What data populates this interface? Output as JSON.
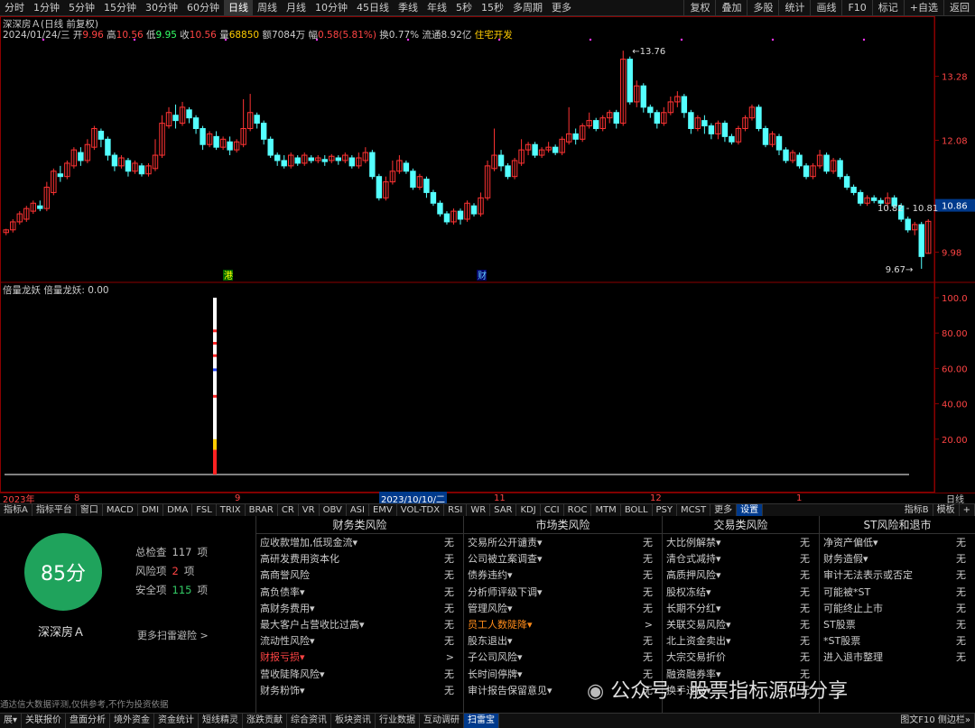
{
  "top_toolbar": {
    "periods": [
      "分时",
      "1分钟",
      "5分钟",
      "15分钟",
      "30分钟",
      "60分钟",
      "日线",
      "周线",
      "月线",
      "10分钟",
      "45日线",
      "季线",
      "年线",
      "5秒",
      "15秒",
      "多周期",
      "更多"
    ],
    "active_period": "日线",
    "right_buttons": [
      "复权",
      "叠加",
      "多股",
      "统计",
      "画线",
      "F10",
      "标记",
      "+自选",
      "返回"
    ]
  },
  "stock_header": {
    "title": "深深房Ａ(日线 前复权)",
    "date": "2024/01/24/三",
    "open_label": "开",
    "open": "9.96",
    "high_label": "高",
    "high": "10.56",
    "low_label": "低",
    "low": "9.95",
    "close_label": "收",
    "close": "10.56",
    "volume_label": "量",
    "volume": "68850",
    "amount_label": "额",
    "amount": "7084万",
    "change_label": "幅",
    "change": "0.58(5.81%)",
    "turnover_label": "换",
    "turnover": "0.77%",
    "float_label": "流通",
    "float": "8.92亿",
    "sector": "住宅开发"
  },
  "price_axis": {
    "ticks": [
      "13.28",
      "12.08",
      "10.86",
      "9.98"
    ],
    "current": "10.86"
  },
  "annotations": {
    "high_mark": "13.76",
    "low_mark": "9.67",
    "range_label": "10.82 - 10.81",
    "marker_a": "港",
    "marker_b": "财"
  },
  "colors": {
    "up": "#ff3333",
    "down": "#54ffff",
    "grid": "#8b0000",
    "accent": "#003a8c",
    "score_bg": "#1fa35c"
  },
  "indicator": {
    "title": "倍量龙妖  倍量龙妖: 0.00",
    "ticks": [
      "100.0",
      "80.00",
      "60.00",
      "40.00",
      "20.00"
    ]
  },
  "timeline": {
    "labels": [
      "2023年",
      "8",
      "9",
      "2023/10/10/二",
      "11",
      "12",
      "1"
    ],
    "right": "日线"
  },
  "indicator_tabs": {
    "items": [
      "指标A",
      "指标平台",
      "窗口",
      "MACD",
      "DMI",
      "DMA",
      "FSL",
      "TRIX",
      "BRAR",
      "CR",
      "VR",
      "OBV",
      "ASI",
      "EMV",
      "VOL-TDX",
      "RSI",
      "WR",
      "SAR",
      "KDJ",
      "CCI",
      "ROC",
      "MTM",
      "BOLL",
      "PSY",
      "MCST",
      "更多",
      "设置"
    ],
    "right": [
      "指标B",
      "模板",
      "+"
    ]
  },
  "risk_panel": {
    "score": "85分",
    "stock_name": "深深房Ａ",
    "total_label": "总检查",
    "total": "117",
    "unit": "项",
    "risk_label": "风险项",
    "risk": "2",
    "safe_label": "安全项",
    "safe": "115",
    "more": "更多扫雷避险 >",
    "columns": [
      {
        "title": "财务类风险",
        "rows": [
          {
            "label": "应收款增加,低现金流▾",
            "status": "无"
          },
          {
            "label": "高研发费用资本化",
            "status": "无"
          },
          {
            "label": "高商誉风险",
            "status": "无"
          },
          {
            "label": "高负债率▾",
            "status": "无"
          },
          {
            "label": "高财务费用▾",
            "status": "无"
          },
          {
            "label": "最大客户占营收比过高▾",
            "status": "无"
          },
          {
            "label": "流动性风险▾",
            "status": "无"
          },
          {
            "label": "财报亏损▾",
            "status": ">",
            "level": "bad"
          },
          {
            "label": "营收陡降风险▾",
            "status": "无"
          },
          {
            "label": "财务粉饰▾",
            "status": "无"
          }
        ]
      },
      {
        "title": "市场类风险",
        "rows": [
          {
            "label": "交易所公开谴责▾",
            "status": "无"
          },
          {
            "label": "公司被立案调查▾",
            "status": "无"
          },
          {
            "label": "债券违约▾",
            "status": "无"
          },
          {
            "label": "分析师评级下调▾",
            "status": "无"
          },
          {
            "label": "管理风险▾",
            "status": "无"
          },
          {
            "label": "员工人数陡降▾",
            "status": ">",
            "level": "warn"
          },
          {
            "label": "股东退出▾",
            "status": "无"
          },
          {
            "label": "子公司风险▾",
            "status": "无"
          },
          {
            "label": "长时间停牌▾",
            "status": "无"
          },
          {
            "label": "审计报告保留意见▾",
            "status": "无"
          }
        ]
      },
      {
        "title": "交易类风险",
        "rows": [
          {
            "label": "大比例解禁▾",
            "status": "无"
          },
          {
            "label": "清仓式减持▾",
            "status": "无"
          },
          {
            "label": "高质押风险▾",
            "status": "无"
          },
          {
            "label": "股权冻结▾",
            "status": "无"
          },
          {
            "label": "长期不分红▾",
            "status": "无"
          },
          {
            "label": "关联交易风险▾",
            "status": "无"
          },
          {
            "label": "北上资金卖出▾",
            "status": "无"
          },
          {
            "label": "大宗交易折价",
            "status": "无"
          },
          {
            "label": "融资融券率▾",
            "status": "无"
          },
          {
            "label": "换手过高▾",
            "status": "无"
          }
        ]
      },
      {
        "title": "ST风险和退市",
        "rows": [
          {
            "label": "净资产偏低▾",
            "status": "无"
          },
          {
            "label": "财务造假▾",
            "status": "无"
          },
          {
            "label": "审计无法表示或否定",
            "status": "无"
          },
          {
            "label": "可能被*ST",
            "status": "无"
          },
          {
            "label": "可能终止上市",
            "status": "无"
          },
          {
            "label": "ST股票",
            "status": "无"
          },
          {
            "label": "*ST股票",
            "status": "无"
          },
          {
            "label": "进入退市整理",
            "status": "无"
          }
        ]
      }
    ],
    "disclaimer": "通达信大数据评测,仅供参考,不作为投资依据"
  },
  "watermark": "公众号 · 股票指标源码分享",
  "bottom_bar": {
    "items": [
      "展▾",
      "关联报价",
      "盘面分析",
      "境外资金",
      "资金统计",
      "短线精灵",
      "涨跌贡献",
      "综合资讯",
      "板块资讯",
      "行业数据",
      "互动调研",
      "扫雷宝"
    ],
    "active": "扫雷宝",
    "right": "图文F10 侧边栏»"
  },
  "chart_data": {
    "type": "candlestick",
    "title": "深深房Ａ(日线 前复权)",
    "ylim": [
      9.5,
      14.0
    ],
    "candles": [
      [
        10.35,
        10.4,
        10.3,
        10.42
      ],
      [
        10.4,
        10.55,
        10.35,
        10.6
      ],
      [
        10.55,
        10.7,
        10.5,
        10.75
      ],
      [
        10.6,
        10.8,
        10.55,
        10.85
      ],
      [
        10.75,
        10.9,
        10.7,
        10.95
      ],
      [
        10.85,
        10.8,
        10.75,
        10.95
      ],
      [
        10.8,
        11.2,
        10.75,
        11.3
      ],
      [
        11.1,
        11.5,
        11.05,
        11.55
      ],
      [
        11.45,
        11.4,
        11.3,
        11.6
      ],
      [
        11.4,
        11.65,
        11.35,
        11.7
      ],
      [
        11.6,
        11.9,
        11.55,
        11.95
      ],
      [
        11.85,
        11.7,
        11.6,
        11.95
      ],
      [
        11.7,
        12.0,
        11.65,
        12.1
      ],
      [
        11.95,
        12.3,
        11.9,
        12.35
      ],
      [
        12.25,
        12.1,
        11.95,
        12.3
      ],
      [
        12.1,
        11.8,
        11.7,
        12.15
      ],
      [
        11.8,
        11.6,
        11.5,
        11.85
      ],
      [
        11.6,
        11.75,
        11.55,
        11.8
      ],
      [
        11.7,
        11.5,
        11.4,
        11.75
      ],
      [
        11.5,
        11.65,
        11.45,
        11.7
      ],
      [
        11.6,
        11.45,
        11.4,
        11.65
      ],
      [
        11.45,
        11.6,
        11.4,
        11.65
      ],
      [
        11.55,
        11.8,
        11.5,
        12.1
      ],
      [
        11.8,
        12.4,
        11.75,
        12.55
      ],
      [
        12.35,
        12.6,
        12.3,
        12.7
      ],
      [
        12.55,
        12.45,
        12.3,
        12.75
      ],
      [
        12.4,
        12.7,
        12.35,
        12.8
      ],
      [
        12.65,
        12.5,
        12.4,
        12.7
      ],
      [
        12.5,
        12.3,
        12.2,
        12.55
      ],
      [
        12.3,
        12.0,
        11.9,
        12.35
      ],
      [
        12.0,
        12.2,
        11.95,
        12.25
      ],
      [
        12.15,
        11.95,
        11.9,
        12.25
      ],
      [
        11.95,
        12.1,
        11.9,
        12.15
      ],
      [
        12.05,
        11.9,
        11.8,
        12.15
      ],
      [
        11.9,
        12.05,
        11.85,
        12.1
      ],
      [
        12.0,
        12.3,
        11.95,
        12.85
      ],
      [
        12.3,
        12.6,
        12.25,
        12.95
      ],
      [
        12.55,
        12.4,
        12.3,
        12.6
      ],
      [
        12.4,
        12.1,
        12.0,
        12.45
      ],
      [
        12.1,
        11.8,
        11.75,
        12.15
      ],
      [
        11.8,
        11.7,
        11.6,
        11.85
      ],
      [
        11.7,
        11.6,
        11.55,
        11.8
      ],
      [
        11.6,
        11.8,
        11.55,
        11.85
      ],
      [
        11.75,
        11.65,
        11.6,
        11.8
      ],
      [
        11.65,
        11.8,
        11.6,
        11.85
      ],
      [
        11.75,
        11.7,
        11.65,
        11.8
      ],
      [
        11.7,
        11.75,
        11.65,
        11.8
      ],
      [
        11.72,
        11.68,
        11.6,
        11.8
      ],
      [
        11.7,
        11.78,
        11.65,
        11.82
      ],
      [
        11.75,
        11.7,
        11.62,
        11.8
      ],
      [
        11.7,
        11.8,
        11.65,
        11.85
      ],
      [
        11.75,
        11.6,
        11.55,
        11.8
      ],
      [
        11.6,
        11.75,
        11.55,
        11.85
      ],
      [
        11.7,
        11.85,
        11.65,
        11.95
      ],
      [
        11.85,
        11.4,
        11.35,
        11.9
      ],
      [
        11.4,
        11.0,
        10.95,
        11.45
      ],
      [
        11.0,
        11.3,
        10.95,
        11.4
      ],
      [
        11.3,
        11.5,
        11.25,
        11.7
      ],
      [
        11.5,
        11.7,
        11.45,
        11.8
      ],
      [
        11.65,
        11.5,
        11.45,
        11.7
      ],
      [
        11.5,
        11.2,
        11.15,
        11.55
      ],
      [
        11.2,
        11.4,
        11.15,
        11.45
      ],
      [
        11.35,
        11.1,
        11.0,
        11.4
      ],
      [
        11.1,
        10.9,
        10.85,
        11.15
      ],
      [
        10.9,
        10.7,
        10.65,
        10.95
      ],
      [
        10.7,
        10.55,
        10.5,
        10.75
      ],
      [
        10.55,
        10.75,
        10.5,
        10.8
      ],
      [
        10.75,
        10.6,
        10.5,
        10.8
      ],
      [
        10.6,
        10.9,
        10.55,
        10.95
      ],
      [
        10.85,
        10.7,
        10.65,
        10.9
      ],
      [
        10.7,
        11.0,
        10.65,
        11.1
      ],
      [
        11.0,
        11.6,
        10.95,
        11.7
      ],
      [
        11.55,
        11.8,
        11.5,
        12.3
      ],
      [
        11.8,
        11.6,
        11.5,
        11.9
      ],
      [
        11.6,
        11.4,
        11.35,
        11.65
      ],
      [
        11.4,
        11.7,
        11.35,
        11.75
      ],
      [
        11.65,
        11.9,
        11.6,
        12.1
      ],
      [
        11.9,
        12.0,
        11.8,
        12.05
      ],
      [
        12.0,
        11.8,
        11.75,
        12.05
      ],
      [
        11.8,
        11.9,
        11.75,
        11.95
      ],
      [
        11.9,
        11.95,
        11.85,
        12.05
      ],
      [
        11.95,
        11.85,
        11.8,
        12.0
      ],
      [
        11.85,
        12.1,
        11.8,
        12.15
      ],
      [
        12.05,
        12.2,
        12.0,
        12.7
      ],
      [
        12.2,
        12.1,
        12.0,
        12.3
      ],
      [
        12.1,
        12.35,
        12.05,
        12.4
      ],
      [
        12.35,
        12.45,
        12.3,
        12.6
      ],
      [
        12.45,
        12.3,
        12.25,
        12.5
      ],
      [
        12.3,
        12.5,
        12.25,
        12.55
      ],
      [
        12.5,
        12.6,
        12.4,
        12.65
      ],
      [
        12.6,
        12.4,
        12.3,
        12.65
      ],
      [
        12.4,
        13.6,
        12.35,
        13.76
      ],
      [
        13.6,
        12.8,
        12.75,
        13.65
      ],
      [
        12.8,
        13.1,
        12.7,
        13.2
      ],
      [
        13.1,
        12.7,
        12.6,
        13.15
      ],
      [
        12.7,
        12.6,
        12.5,
        12.75
      ],
      [
        12.6,
        12.4,
        12.3,
        12.65
      ],
      [
        12.4,
        12.6,
        12.35,
        12.7
      ],
      [
        12.6,
        12.8,
        12.55,
        12.9
      ],
      [
        12.8,
        12.9,
        12.7,
        13.0
      ],
      [
        12.9,
        12.6,
        12.5,
        12.95
      ],
      [
        12.6,
        12.3,
        12.2,
        12.65
      ],
      [
        12.3,
        12.5,
        12.25,
        12.55
      ],
      [
        12.45,
        12.35,
        12.2,
        12.55
      ],
      [
        12.35,
        12.2,
        12.1,
        12.4
      ],
      [
        12.2,
        12.4,
        12.1,
        12.45
      ],
      [
        12.4,
        12.15,
        12.05,
        12.45
      ],
      [
        12.15,
        12.05,
        12.0,
        12.2
      ],
      [
        12.05,
        12.3,
        12.0,
        12.35
      ],
      [
        12.3,
        12.5,
        12.25,
        12.55
      ],
      [
        12.5,
        12.7,
        12.45,
        12.75
      ],
      [
        12.7,
        12.3,
        12.25,
        12.75
      ],
      [
        12.3,
        12.0,
        11.95,
        12.35
      ],
      [
        12.0,
        12.2,
        11.95,
        12.25
      ],
      [
        12.15,
        11.9,
        11.8,
        12.2
      ],
      [
        11.9,
        11.7,
        11.65,
        11.95
      ],
      [
        11.7,
        11.85,
        11.65,
        11.9
      ],
      [
        11.8,
        11.6,
        11.55,
        11.85
      ],
      [
        11.6,
        11.4,
        11.35,
        11.65
      ],
      [
        11.4,
        11.6,
        11.35,
        11.65
      ],
      [
        11.6,
        11.8,
        11.55,
        11.9
      ],
      [
        11.8,
        11.5,
        11.45,
        11.85
      ],
      [
        11.5,
        11.7,
        11.45,
        11.75
      ],
      [
        11.7,
        11.4,
        11.35,
        11.75
      ],
      [
        11.4,
        11.2,
        11.15,
        11.45
      ],
      [
        11.2,
        11.1,
        11.05,
        11.25
      ],
      [
        11.1,
        10.9,
        10.85,
        11.15
      ],
      [
        10.9,
        11.0,
        10.85,
        11.05
      ],
      [
        11.0,
        10.95,
        10.9,
        11.05
      ],
      [
        10.95,
        10.9,
        10.85,
        11.0
      ],
      [
        10.9,
        11.0,
        10.8,
        11.1
      ],
      [
        11.0,
        10.85,
        10.8,
        11.05
      ],
      [
        10.85,
        10.6,
        10.55,
        10.9
      ],
      [
        10.6,
        10.4,
        10.35,
        10.65
      ],
      [
        10.4,
        10.5,
        10.3,
        10.55
      ],
      [
        10.5,
        9.9,
        9.67,
        10.55
      ],
      [
        9.96,
        10.56,
        9.95,
        10.6
      ]
    ],
    "indicator_series": {
      "name": "倍量龙妖",
      "value": 0.0
    }
  }
}
